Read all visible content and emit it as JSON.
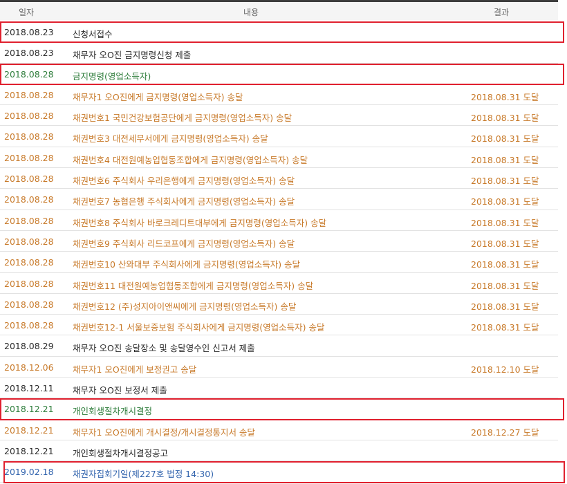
{
  "header": {
    "date": "일자",
    "content": "내용",
    "result": "결과"
  },
  "colors": {
    "dark": "#2b2b2b",
    "orange": "#c87a2a",
    "green": "#2e7d3b",
    "blue": "#3163ad",
    "highlight": "#e0202e"
  },
  "rows": [
    {
      "date": "2018.08.23",
      "content": "신청서접수",
      "result": "",
      "color": "dark",
      "highlighted": true
    },
    {
      "date": "2018.08.23",
      "content": "채무자 오O진 금지명령신청 제출",
      "result": "",
      "color": "dark",
      "highlighted": false
    },
    {
      "date": "2018.08.28",
      "content": "금지명령(영업소득자)",
      "result": "",
      "color": "green",
      "highlighted": true
    },
    {
      "date": "2018.08.28",
      "content": "채무자1 오O진에게 금지명령(영업소득자) 송달",
      "result": "2018.08.31 도달",
      "color": "orange",
      "highlighted": false
    },
    {
      "date": "2018.08.28",
      "content": "채권번호1 국민건강보험공단에게 금지명령(영업소득자) 송달",
      "result": "2018.08.31 도달",
      "color": "orange",
      "highlighted": false
    },
    {
      "date": "2018.08.28",
      "content": "채권번호3 대전세무서에게 금지명령(영업소득자) 송달",
      "result": "2018.08.31 도달",
      "color": "orange",
      "highlighted": false
    },
    {
      "date": "2018.08.28",
      "content": "채권번호4 대전원예농업협동조합에게 금지명령(영업소득자) 송달",
      "result": "2018.08.31 도달",
      "color": "orange",
      "highlighted": false
    },
    {
      "date": "2018.08.28",
      "content": "채권번호6 주식회사 우리은행에게 금지명령(영업소득자) 송달",
      "result": "2018.08.31 도달",
      "color": "orange",
      "highlighted": false
    },
    {
      "date": "2018.08.28",
      "content": "채권번호7 농협은행 주식회사에게 금지명령(영업소득자) 송달",
      "result": "2018.08.31 도달",
      "color": "orange",
      "highlighted": false
    },
    {
      "date": "2018.08.28",
      "content": "채권번호8 주식회사 바로크레디트대부에게 금지명령(영업소득자) 송달",
      "result": "2018.08.31 도달",
      "color": "orange",
      "highlighted": false
    },
    {
      "date": "2018.08.28",
      "content": "채권번호9 주식회사 리드코프에게 금지명령(영업소득자) 송달",
      "result": "2018.08.31 도달",
      "color": "orange",
      "highlighted": false
    },
    {
      "date": "2018.08.28",
      "content": "채권번호10 산와대부 주식회사에게 금지명령(영업소득자) 송달",
      "result": "2018.08.31 도달",
      "color": "orange",
      "highlighted": false
    },
    {
      "date": "2018.08.28",
      "content": "채권번호11 대전원예농업협동조합에게 금지명령(영업소득자) 송달",
      "result": "2018.08.31 도달",
      "color": "orange",
      "highlighted": false
    },
    {
      "date": "2018.08.28",
      "content": "채권번호12 (주)성지아이앤씨에게 금지명령(영업소득자) 송달",
      "result": "2018.08.31 도달",
      "color": "orange",
      "highlighted": false
    },
    {
      "date": "2018.08.28",
      "content": "채권번호12-1 서울보증보험 주식회사에게 금지명령(영업소득자) 송달",
      "result": "2018.08.31 도달",
      "color": "orange",
      "highlighted": false
    },
    {
      "date": "2018.08.29",
      "content": "채무자 오O진 송달장소 및 송달영수인 신고서 제출",
      "result": "",
      "color": "dark",
      "highlighted": false
    },
    {
      "date": "2018.12.06",
      "content": "채무자1 오O진에게 보정권고 송달",
      "result": "2018.12.10 도달",
      "color": "orange",
      "highlighted": false
    },
    {
      "date": "2018.12.11",
      "content": "채무자 오O진 보정서 제출",
      "result": "",
      "color": "dark",
      "highlighted": false
    },
    {
      "date": "2018.12.21",
      "content": "개인회생절차개시결정",
      "result": "",
      "color": "green",
      "highlighted": true
    },
    {
      "date": "2018.12.21",
      "content": "채무자1 오O진에게 개시결정/개시결정통지서 송달",
      "result": "2018.12.27 도달",
      "color": "orange",
      "highlighted": false
    },
    {
      "date": "2018.12.21",
      "content": "개인회생절차개시결정공고",
      "result": "",
      "color": "dark",
      "highlighted": false
    },
    {
      "date": "2019.02.18",
      "content": "채권자집회기일(제227호 법정 14:30)",
      "result": "",
      "color": "blue",
      "highlighted": true
    }
  ]
}
